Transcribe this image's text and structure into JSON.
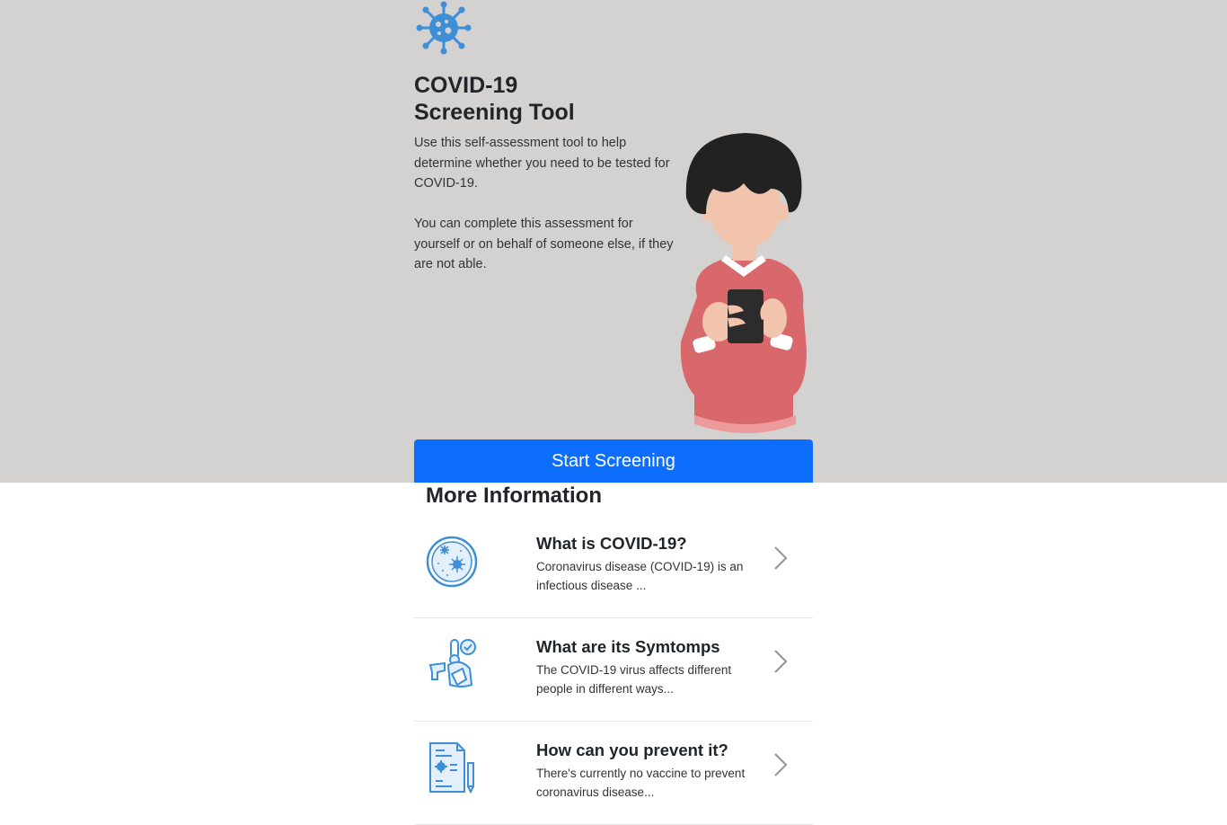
{
  "hero": {
    "title_line1": "COVID-19",
    "title_line2": "Screening Tool",
    "description1": "Use this self-assessment tool to help determine whether you need to be tested for COVID-19.",
    "description2": "You can complete this assessment for yourself or on behalf of someone else, if they are not able.",
    "start_button": "Start Screening",
    "logo_icon": "virus-icon",
    "illustration": "person-with-phone-illustration"
  },
  "more_info": {
    "title": "More Information",
    "items": [
      {
        "heading": "What is COVID-19?",
        "text": "Coronavirus disease (COVID-19) is an infectious disease ...",
        "icon": "petri-dish-virus-icon"
      },
      {
        "heading": "What are its Symtomps",
        "text": "The COVID-19 virus affects different people in different ways...",
        "icon": "symptoms-thermometer-icon"
      },
      {
        "heading": "How can you prevent it?",
        "text": "There's currently no vaccine to prevent coronavirus disease...",
        "icon": "prevention-document-icon"
      }
    ]
  },
  "colors": {
    "hero_background": "#d3d2d0",
    "primary_button": "#0d6efd",
    "icon_blue": "#3e8fd8",
    "sweater": "#d9686c"
  }
}
